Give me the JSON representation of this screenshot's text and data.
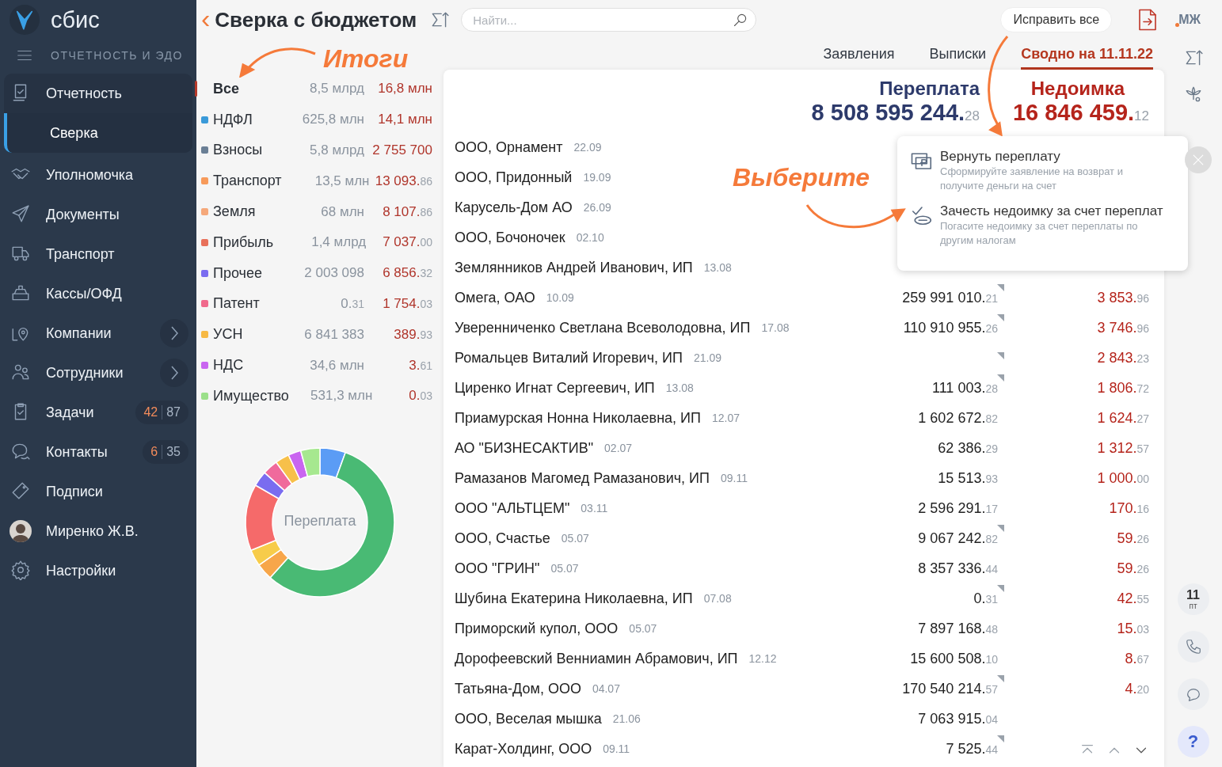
{
  "sidebar": {
    "logo": "сбис",
    "section": "ОТЧЕТНОСТЬ И ЭДО",
    "items": [
      {
        "kind": "link",
        "label": "Отчетность",
        "selected": false,
        "expanded": true,
        "children": [
          {
            "label": "Сверка",
            "selected": true
          }
        ]
      },
      {
        "kind": "link",
        "label": "Уполномочка",
        "selected": false
      },
      {
        "kind": "link",
        "label": "Документы",
        "selected": false
      },
      {
        "kind": "link",
        "label": "Транспорт",
        "selected": false
      },
      {
        "kind": "link",
        "label": "Кассы/ОФД",
        "selected": false
      },
      {
        "kind": "submenu",
        "label": "Компании",
        "selected": false
      },
      {
        "kind": "submenu",
        "label": "Сотрудники",
        "selected": false
      },
      {
        "kind": "counter",
        "label": "Задачи",
        "selected": false,
        "new": "42",
        "total": "87"
      },
      {
        "kind": "counter",
        "label": "Контакты",
        "selected": false,
        "new": "6",
        "total": "35"
      },
      {
        "kind": "link",
        "label": "Подписи",
        "selected": false
      },
      {
        "kind": "user",
        "label": "Миренко Ж.В.",
        "selected": false
      },
      {
        "kind": "link",
        "label": "Настройки",
        "selected": false
      }
    ]
  },
  "header": {
    "back": "‹",
    "title": "Сверка с бюджетом",
    "search": {
      "placeholder": "Найти..."
    },
    "fix_button": "Исправить все",
    "user_initials": "МЖ"
  },
  "tabs": [
    {
      "label": "Заявления",
      "selected": false
    },
    {
      "label": "Выписки",
      "selected": false
    },
    {
      "label": "Сводно на 11.11.22",
      "selected": true
    }
  ],
  "totals": [
    {
      "name": "Все",
      "selected": true,
      "overpay": "8,5 млрд",
      "debt": "16,8 млн"
    },
    {
      "name": "НДФЛ",
      "selected": false,
      "color": "#3a9ad9",
      "overpay": "625,8 млн",
      "debt": "14,1 млн"
    },
    {
      "name": "Взносы",
      "selected": false,
      "color": "#6a7f95",
      "overpay": "5,8 млрд",
      "debt": "2 755 700"
    },
    {
      "name": "Транспорт",
      "selected": false,
      "color": "#f79a5a",
      "overpay": "13,5 млн",
      "debt": "13 093.86"
    },
    {
      "name": "Земля",
      "selected": false,
      "color": "#f5a87a",
      "overpay": "68 млн",
      "debt": "8 107.86"
    },
    {
      "name": "Прибыль",
      "selected": false,
      "color": "#e8705a",
      "overpay": "1,4 млрд",
      "debt": "7 037.00"
    },
    {
      "name": "Прочее",
      "selected": false,
      "color": "#7a6cf0",
      "overpay": "2 003 098",
      "debt": "6 856.32"
    },
    {
      "name": "Патент",
      "selected": false,
      "color": "#f06a8c",
      "overpay": "0.31",
      "debt": "1 754.03"
    },
    {
      "name": "УСН",
      "selected": false,
      "color": "#f7b944",
      "overpay": "6 841 383",
      "debt": "389.93"
    },
    {
      "name": "НДС",
      "selected": false,
      "color": "#c965f0",
      "overpay": "34,6 млн",
      "debt": "3.61"
    },
    {
      "name": "Имущество",
      "selected": false,
      "color": "#9be08a",
      "overpay": "531,3 млн",
      "debt": "0.03"
    }
  ],
  "donut_label": "Переплата",
  "summary": {
    "overpay_label": "Переплата",
    "overpay": "8 508 595 244.28",
    "debt_label": "Недоимка",
    "debt": "16 846 459.12"
  },
  "rows": [
    {
      "name": "ООО, Орнамент",
      "date": "22.09",
      "flagged": false
    },
    {
      "name": "ООО, Придонный",
      "date": "19.09",
      "flagged": false
    },
    {
      "name": "Карусель-Дом   АО",
      "date": "26.09",
      "flagged": false
    },
    {
      "name": "ООО, Бочоночек",
      "date": "02.10",
      "flagged": false
    },
    {
      "name": "Землянников Андрей Иванович, ИП",
      "date": "13.08",
      "flagged": false
    },
    {
      "name": "Омега, ОАО",
      "date": "10.09",
      "overpay": "259 991 010.21",
      "debt": "3 853.96",
      "flagged": true
    },
    {
      "name": "Уверенниченко Светлана Всеволодовна, ИП",
      "date": "17.08",
      "overpay": "110 910 955.26",
      "debt": "3 746.96",
      "flagged": true
    },
    {
      "name": "Ромальцев Виталий Игоревич, ИП",
      "date": "21.09",
      "debt": "2 843.23",
      "flagged": true
    },
    {
      "name": "Циренко Игнат Сергеевич, ИП",
      "date": "13.08",
      "overpay": "111 003.28",
      "debt": "1 806.72",
      "flagged": true
    },
    {
      "name": "Приамурская Нонна Николаевна, ИП",
      "date": "12.07",
      "overpay": "1 602 672.82",
      "debt": "1 624.27",
      "flagged": false
    },
    {
      "name": "АО \"БИЗНЕСАКТИВ\"",
      "date": "02.07",
      "overpay": "62 386.29",
      "debt": "1 312.57",
      "flagged": false
    },
    {
      "name": "Рамазанов Магомед Рамазанович, ИП",
      "date": "09.11",
      "overpay": "15 513.93",
      "debt": "1 000.00",
      "flagged": false
    },
    {
      "name": "ООО \"АЛЬТЦЕМ\"",
      "date": "03.11",
      "overpay": "2 596 291.17",
      "debt": "170.16",
      "flagged": false
    },
    {
      "name": "ООО, Счастье",
      "date": "05.07",
      "overpay": "9 067 242.82",
      "debt": "59.26",
      "flagged": true
    },
    {
      "name": "ООО \"ГРИН\"",
      "date": "05.07",
      "overpay": "8 357 336.44",
      "debt": "59.26",
      "flagged": false
    },
    {
      "name": "Шубина Екатерина Николаевна, ИП",
      "date": "07.08",
      "overpay": "0.31",
      "debt": "42.55",
      "flagged": true
    },
    {
      "name": "Приморский купол, ООО",
      "date": "05.07",
      "overpay": "7 897 168.48",
      "debt": "15.03",
      "flagged": false
    },
    {
      "name": "Дорофеевский Венниамин Абрамович, ИП",
      "date": "12.12",
      "overpay": "15 600 508.10",
      "debt": "8.67",
      "flagged": false
    },
    {
      "name": "Татьяна-Дом, ООО",
      "date": "04.07",
      "overpay": "170 540 214.57",
      "debt": "4.20",
      "flagged": true
    },
    {
      "name": "ООО, Веселая мышка",
      "date": "21.06",
      "overpay": "7 063 915.04",
      "flagged": false
    },
    {
      "name": "Карат-Холдинг, ООО",
      "date": "09.11",
      "overpay": "7 525.44",
      "flagged": true
    }
  ],
  "popup": [
    {
      "title": "Вернуть переплату",
      "text": "Сформируйте заявление на возврат и получите деньги на счет"
    },
    {
      "title": "Зачесть недоимку за счет переплат",
      "text": "Погасите недоимку за счет переплаты по другим налогам"
    }
  ],
  "annotations": [
    {
      "kind": "totals",
      "text": "Итоги"
    },
    {
      "kind": "choose",
      "text": "Выберите"
    }
  ],
  "rail": {
    "day": "11",
    "weekday": "пт",
    "help": "?"
  }
}
